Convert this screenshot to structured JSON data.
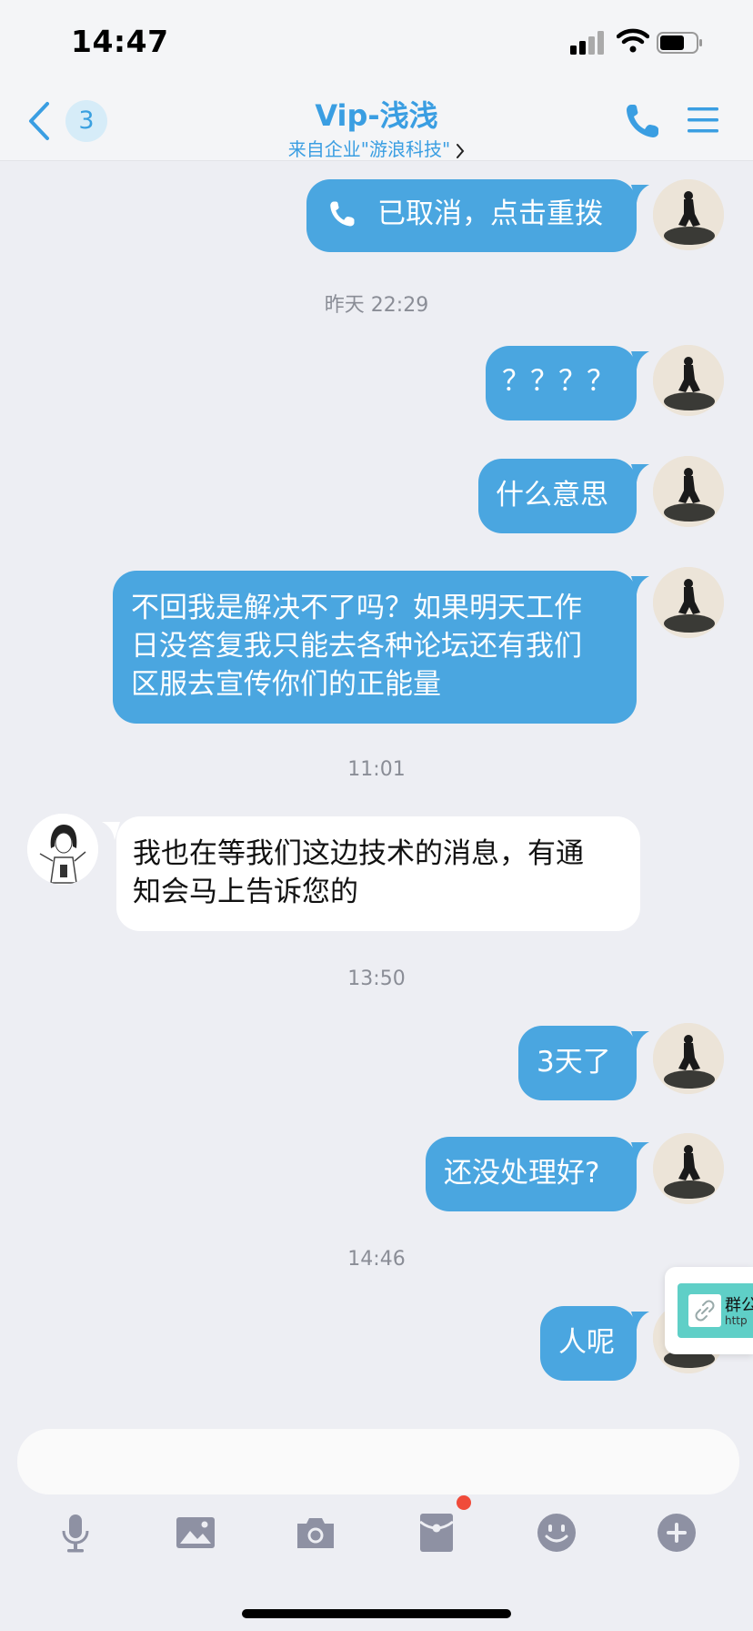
{
  "status_bar": {
    "time": "14:47"
  },
  "header": {
    "unread_count": "3",
    "title": "Vip-浅浅",
    "subtitle": "来自企业\"游浪科技\""
  },
  "messages": [
    {
      "type": "outgoing",
      "call_icon": "phone-icon",
      "text": "已取消，点击重拨"
    },
    {
      "type": "timestamp",
      "text": "昨天 22:29"
    },
    {
      "type": "outgoing",
      "text": "？？？？"
    },
    {
      "type": "outgoing",
      "text": "什么意思"
    },
    {
      "type": "outgoing",
      "lines": [
        "不回我是解决不了吗？如果明天工作",
        "日没答复我只能去各种论坛还有我们",
        "区服去宣传你们的正能量"
      ]
    },
    {
      "type": "timestamp",
      "text": "11:01"
    },
    {
      "type": "incoming",
      "lines": [
        "我也在等我们这边技术的消息，有通",
        "知会马上告诉您的"
      ]
    },
    {
      "type": "timestamp",
      "text": "13:50"
    },
    {
      "type": "outgoing",
      "text": "3天了"
    },
    {
      "type": "outgoing",
      "text": "还没处理好?"
    },
    {
      "type": "timestamp",
      "text": "14:46"
    },
    {
      "type": "outgoing",
      "text": "人呢"
    }
  ],
  "floating_card": {
    "title": "群公",
    "url": "http"
  },
  "input": {
    "value": ""
  },
  "toolbar": [
    "microphone-icon",
    "image-icon",
    "camera-icon",
    "red-packet-icon",
    "emoji-icon",
    "plus-icon"
  ],
  "colors": {
    "accent": "#3a9ee2",
    "bubble_out": "#4aa6e0",
    "bubble_in": "#ffffff",
    "background": "#edeef3",
    "notice_dot": "#f04b3a"
  }
}
